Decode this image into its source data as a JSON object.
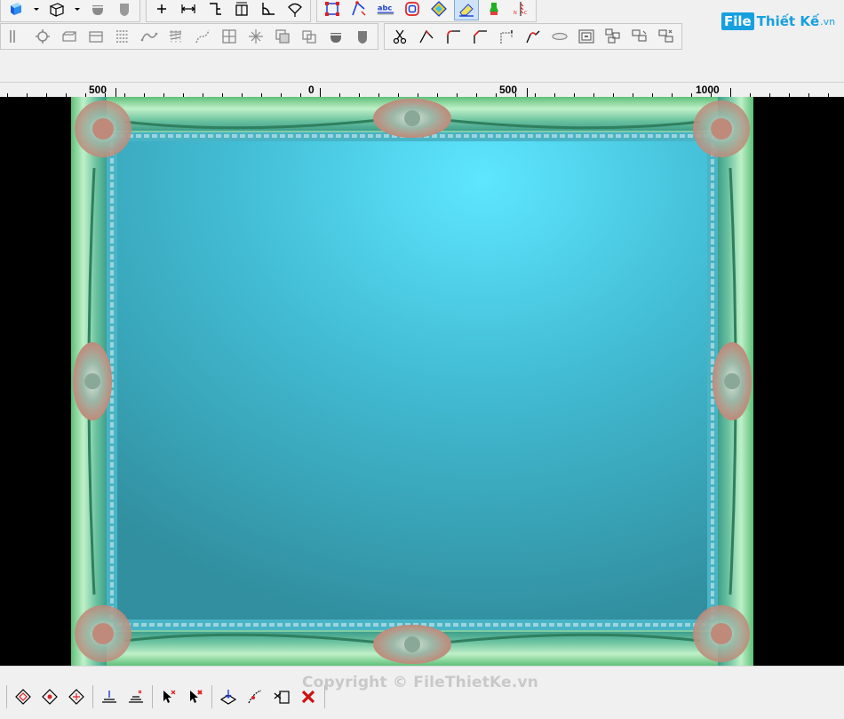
{
  "logo": {
    "brand_box": "File",
    "brand_rest": "Thiết Kế",
    "brand_tld": ".vn"
  },
  "ruler": {
    "labels": [
      "500",
      "0",
      "500",
      "1000"
    ]
  },
  "watermark": {
    "copyright": "Copyright © FileThietKe.vn"
  },
  "toolbar_text": {
    "abc": "abc"
  },
  "colors": {
    "frame_blue": "#3ea7b9",
    "frame_green": "#6fce8a",
    "ornament_rose": "#c08a7a",
    "logo_blue": "#16a0e0"
  }
}
